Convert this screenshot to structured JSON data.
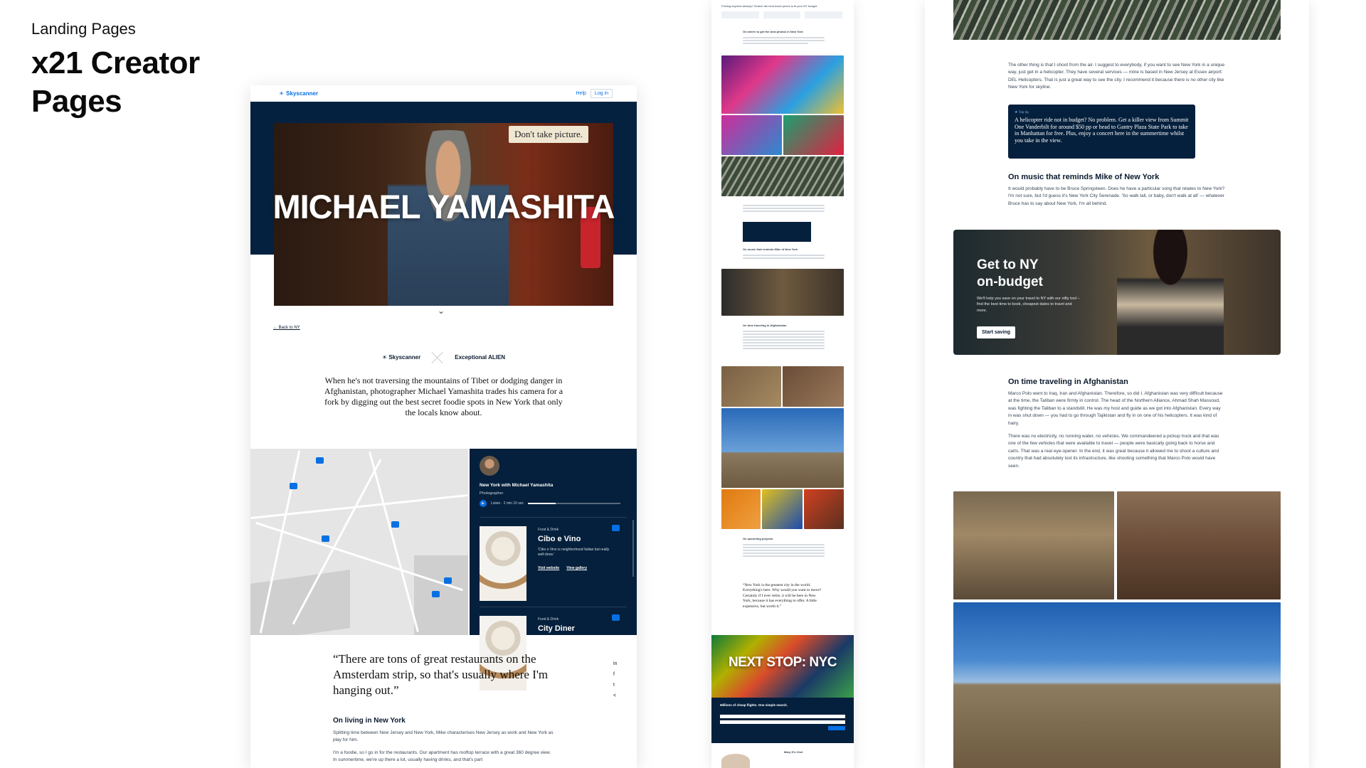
{
  "intro": {
    "subtitle": "Landing Pages",
    "title_line1": "x21 Creator",
    "title_line2": "Pages"
  },
  "page": {
    "nav": {
      "brand": "Skyscanner",
      "help": "Help",
      "login": "Log in"
    },
    "hero": {
      "title": "MICHAEL YAMASHITA",
      "sign": "Don't take picture."
    },
    "back": "Back to NY",
    "partners": {
      "left": "Skyscanner",
      "right": "Exceptional ALIEN"
    },
    "lead": "When he's not traversing the mountains of Tibet or dodging danger in Afghanistan, photographer Michael Yamashita trades his camera for a fork by digging out the best secret foodie spots in New York that only the locals know about.",
    "panel": {
      "title": "New York with Michael Yamashita",
      "role": "Photographer",
      "listen": "Listen · 2 min 10 sec",
      "progress": 0.3,
      "cards": [
        {
          "category": "Food & Drink",
          "name": "Cibo e Vino",
          "desc": "'Cibo e Vino is neighborhood Italian but really well done.'",
          "link1": "Visit website",
          "link2": "View gallery"
        },
        {
          "category": "Food & Drink",
          "name": "City Diner"
        }
      ]
    },
    "quote": "“There are tons of great restaurants on the Amsterdam strip, so that's usually where I'm hanging out.”",
    "share_icons": [
      "linkedin-icon",
      "facebook-icon",
      "twitter-icon",
      "share-icon"
    ],
    "living": {
      "heading": "On living in New York",
      "p1": "Splitting time between New Jersey and New York, Mike characterises New Jersey as work and New York as play for him.",
      "p2": "I'm a foodie, so I go in for the restaurants. Our apartment has rooftop terrace with a great 360 degree view. In summertime, we're up there a lot, usually having drinks, and that's part"
    }
  },
  "long": {
    "top": "Feeling inspired already? Search the best travel prices to fit your NY budget.",
    "h1": "On where to get the best photos in New York",
    "h2": "On music that reminds Mike of New York",
    "h3": "On time traveling in Afghanistan",
    "h4": "On upcoming projects",
    "quote": "“New York is the greatest city in the world. Everything's here. Why would you want to move? Certainly if I ever retire, it will be here in New York, because it has everything to offer. A little expensive, but worth it.”",
    "nextstop": "NEXT STOP: NYC",
    "nextstop_sub": "Millions of cheap flights. One simple search.",
    "footer_name": "Mary H’s Chel"
  },
  "detail": {
    "p_air": "The other thing is that I shoot from the air. I suggest to everybody, if you want to see New York in a unique way, just get in a helicopter. They have several services — mine is based in New Jersey at Essex airport: DEL Helicopters. That is just a great way to see the city. I recommend it because there is no other city like New York for skyline.",
    "tip_label": "Top tip",
    "tip_text": "A helicopter ride not in budget? No problem. Get a killer view from Summit One Vanderbilt for around $50 pp or head to Gantry Plaza State Park to take in Manhattan for free. Plus, enjoy a concert here in the summertime whilst you take in the view.",
    "music_heading": "On music that reminds Mike of New York",
    "music_text": "It would probably have to be Bruce Springsteen. Does he have a particular song that relates to New York? I'm not sure, but I'd guess it's New York City Serenade. 'So walk tall, or baby, don't walk at all' — whatever Bruce has to say about New York, I'm all behind.",
    "promo_title_1": "Get to NY",
    "promo_title_2": "on-budget",
    "promo_desc": "We'll help you save on your travel to NY with our nifty tool – find the best time to book, cheapest dates to travel and more.",
    "promo_button": "Start saving",
    "afg_heading": "On time traveling in Afghanistan",
    "afg_p1": "Marco Polo went to Iraq, Iran and Afghanistan. Therefore, so did I. Afghanistan was very difficult because at the time, the Taliban were firmly in control. The head of the Northern Alliance, Ahmad Shah Massoud, was fighting the Taliban to a standstill. He was my host and guide as we got into Afghanistan. Every way in was shut down — you had to go through Tajikistan and fly in on one of his helicopters. It was kind of hairy.",
    "afg_p2": "There was no electricity, no running water, no vehicles. We commandeered a pickup truck and that was one of the few vehicles that were available to travel — people were basically going back to horse and carts. That was a real eye-opener. In the end, it was great because it allowed me to shoot a culture and country that had absolutely lost its infrastructure, like shooting something that Marco Polo would have seen."
  }
}
